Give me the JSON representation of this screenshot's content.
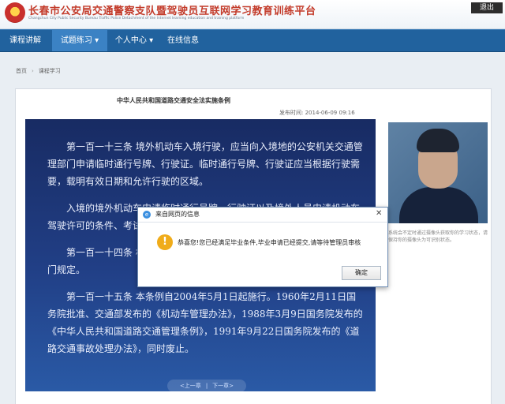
{
  "header": {
    "title": "长春市公安局交通警察支队暨驾驶员互联网学习教育训练平台",
    "subtitle": "Changchun City Public Security Bureau Traffic Police Detachment of the Internet learning education and training platform",
    "logout_label": "退出"
  },
  "nav": {
    "items": [
      {
        "label": "课程讲解"
      },
      {
        "label": "试题练习 ▾"
      },
      {
        "label": "个人中心 ▾"
      },
      {
        "label": "在线信息"
      }
    ]
  },
  "breadcrumb": {
    "home": "首页",
    "current": "课程学习"
  },
  "document": {
    "title": "中华人民共和国道路交通安全法实施条例",
    "publish_time": "发布时间: 2014-06-09 09:16",
    "paragraphs": [
      "第一百一十三条 境外机动车入境行驶，应当向入境地的公安机关交通管理部门申请临时通行号牌、行驶证。临时通行号牌、行驶证应当根据行驶需要，载明有效日期和允许行驶的区域。",
      "入境的境外机动车申请临时通行号牌、行驶证以及境外人员申请机动车驾驶许可的条件、考试办法由国务院公安部门规定。",
      "第一百一十四条 机动车驾驶许可考试的收费标准，由国务院价格主管部门规定。",
      "第一百一十五条 本条例自2004年5月1日起施行。1960年2月11日国务院批准、交通部发布的《机动车管理办法》，1988年3月9日国务院发布的《中华人民共和国道路交通管理条例》，1991年9月22日国务院发布的《道路交通事故处理办法》，同时废止。"
    ],
    "pager": {
      "prev": "<上一章",
      "sep": "|",
      "next": "下一章>"
    }
  },
  "photo_note": "系统会不定时通过摄像头获取你的学习状态，请保持你的摄像头为可识别状态。",
  "dialog": {
    "title": "来自网页的信息",
    "close": "✕",
    "message": "恭喜您!您已经满足毕业条件,毕业申请已经提交,请等待管理员审核",
    "ok_label": "确定",
    "warn_glyph": "!",
    "icon_glyph": "e"
  }
}
